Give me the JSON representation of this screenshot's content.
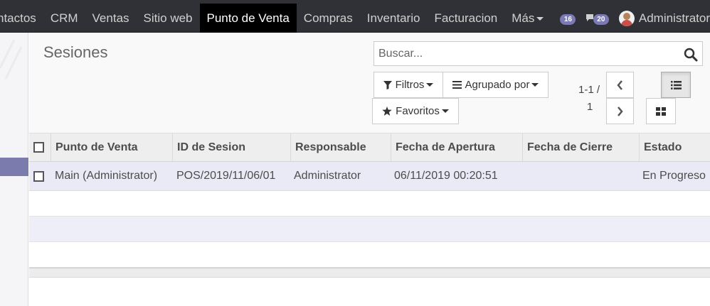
{
  "navbar": {
    "menu": [
      "ntactos",
      "CRM",
      "Ventas",
      "Sitio web",
      "Punto de Venta",
      "Compras",
      "Inventario",
      "Facturacion"
    ],
    "active": "Punto de Venta",
    "more_label": "Más",
    "activity_count": "16",
    "message_count": "20",
    "user_name": "Administrator"
  },
  "control_panel": {
    "title": "Sesiones",
    "search_placeholder": "Buscar...",
    "filters_label": "Filtros",
    "groupby_label": "Agrupado por",
    "favorites_label": "Favoritos",
    "pager_range": "1-1 /",
    "pager_total": "1"
  },
  "table": {
    "columns": [
      "Punto de Venta",
      "ID de Sesion",
      "Responsable",
      "Fecha de Apertura",
      "Fecha de Cierre",
      "Estado"
    ],
    "rows": [
      [
        "Main (Administrator)",
        "POS/2019/11/06/01",
        "Administrator",
        "06/11/2019 00:20:51",
        "",
        "En Progreso"
      ]
    ]
  },
  "colors": {
    "navbar_bg": "#2f3136",
    "accent": "#7c7bad",
    "badge": "#7b7ab3"
  }
}
